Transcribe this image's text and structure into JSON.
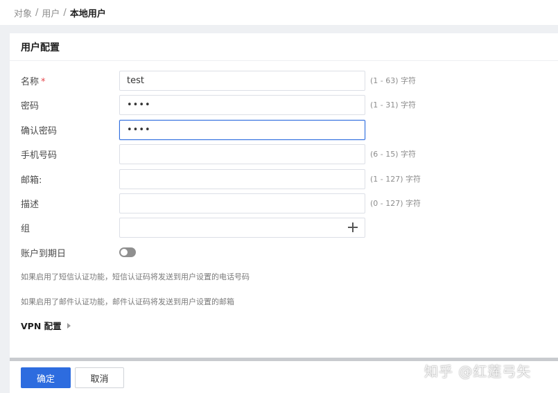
{
  "breadcrumb": {
    "items": [
      "对象",
      "用户"
    ],
    "separator": "/",
    "current": "本地用户"
  },
  "card": {
    "title": "用户配置"
  },
  "form": {
    "name": {
      "label": "名称",
      "required_mark": "*",
      "value": "test",
      "hint": "(1 - 63) 字符"
    },
    "password": {
      "label": "密码",
      "value": "••••",
      "hint": "(1 - 31) 字符"
    },
    "confirm_password": {
      "label": "确认密码",
      "value": "••••"
    },
    "phone": {
      "label": "手机号码",
      "value": "",
      "hint": "(6 - 15) 字符"
    },
    "email": {
      "label": "邮箱:",
      "value": "",
      "hint": "(1 - 127) 字符"
    },
    "description": {
      "label": "描述",
      "value": "",
      "hint": "(0 - 127) 字符"
    },
    "group": {
      "label": "组",
      "icon": "plus-icon"
    },
    "expiry": {
      "label": "账户到期日",
      "enabled": false
    }
  },
  "notes": {
    "sms": "如果启用了短信认证功能，短信认证码将发送到用户设置的电话号码",
    "mail": "如果启用了邮件认证功能，邮件认证码将发送到用户设置的邮箱"
  },
  "vpn": {
    "label": "VPN 配置",
    "icon": "triangle-right-icon"
  },
  "footer": {
    "confirm_label": "确定",
    "cancel_label": "取消"
  },
  "watermark": {
    "text": "知乎 @红莲弓矢"
  },
  "colors": {
    "primary": "#2d6cdf",
    "required": "#e5484d",
    "page_bg": "#eef0f3"
  }
}
